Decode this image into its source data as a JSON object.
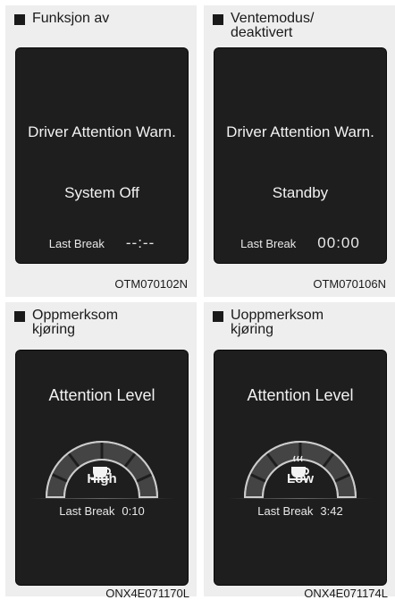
{
  "panels": [
    {
      "heading_line1": "Funksjon av",
      "heading_line2": "",
      "title": "Driver Attention Warn.",
      "status": "System Off",
      "last_break_label": "Last Break",
      "last_break_value": "--:--",
      "code": "OTM070102N"
    },
    {
      "heading_line1": "Ventemodus/",
      "heading_line2": "deaktivert",
      "title": "Driver Attention Warn.",
      "status": "Standby",
      "last_break_label": "Last Break",
      "last_break_value": "00:00",
      "code": "OTM070106N"
    },
    {
      "heading_line1": "Oppmerksom",
      "heading_line2": "kjøring",
      "title": "Attention Level",
      "level": "High",
      "level_fraction": 0.85,
      "last_break_label": "Last Break",
      "last_break_value": "0:10",
      "icon": "coffee-cup-icon",
      "code": "ONX4E071170L"
    },
    {
      "heading_line1": "Uoppmerksom",
      "heading_line2": "kjøring",
      "title": "Attention Level",
      "level": "Low",
      "level_fraction": 0.2,
      "last_break_label": "Last Break",
      "last_break_value": "3:42",
      "icon": "steaming-coffee-cup-icon",
      "code": "ONX4E071174L"
    }
  ],
  "colors": {
    "panel_bg": "#eeeeee",
    "screen_bg": "#1e1e1e",
    "text_on_screen": "#f2f2f2"
  }
}
